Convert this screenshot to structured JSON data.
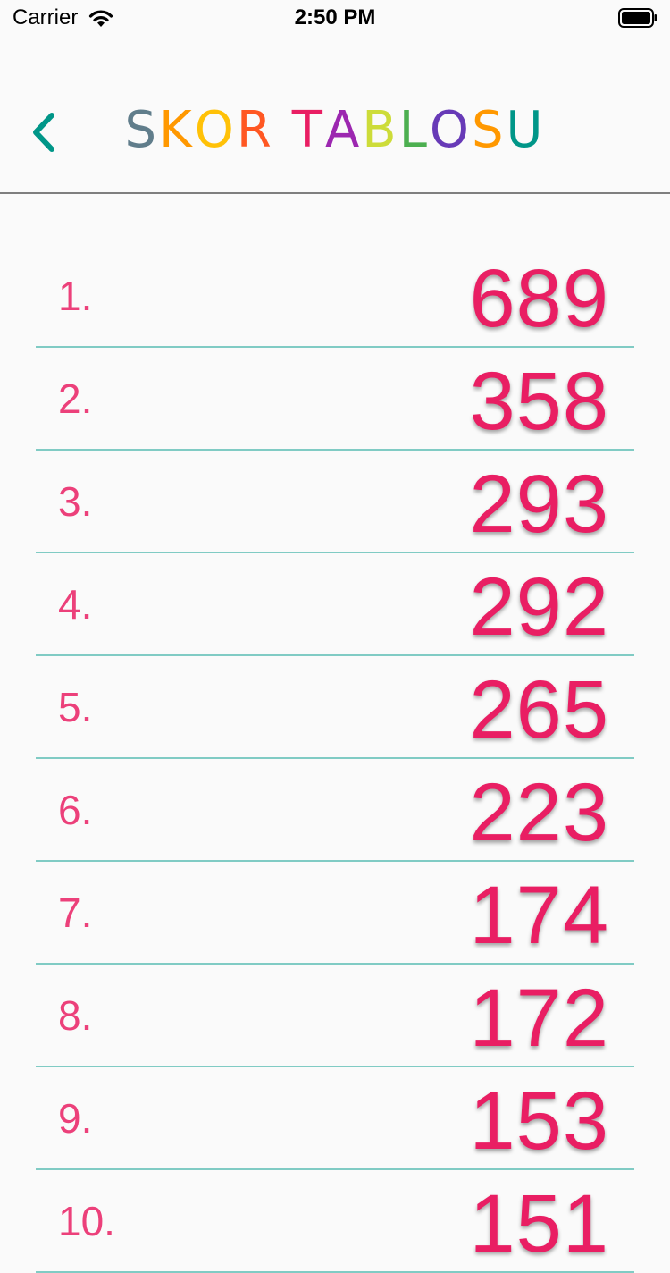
{
  "status_bar": {
    "carrier": "Carrier",
    "time": "2:50 PM"
  },
  "nav": {
    "back_icon": "chevron-left-icon",
    "title": "SKOR TABLOSU",
    "title_letters": [
      {
        "char": "S",
        "color": "#607d8b"
      },
      {
        "char": "K",
        "color": "#ff9800"
      },
      {
        "char": "O",
        "color": "#ffc107"
      },
      {
        "char": "R",
        "color": "#ff5722"
      },
      {
        "char": " ",
        "color": "#000000"
      },
      {
        "char": "T",
        "color": "#e91e63"
      },
      {
        "char": "A",
        "color": "#9c27b0"
      },
      {
        "char": "B",
        "color": "#cddc39"
      },
      {
        "char": "L",
        "color": "#4caf50"
      },
      {
        "char": "O",
        "color": "#673ab7"
      },
      {
        "char": "S",
        "color": "#ff9800"
      },
      {
        "char": "U",
        "color": "#009688"
      }
    ]
  },
  "colors": {
    "back": "#009688",
    "rank": "#ec407a",
    "score": "#e91e63",
    "divider": "#80cbc4"
  },
  "scores": [
    {
      "rank": "1.",
      "score": "689"
    },
    {
      "rank": "2.",
      "score": "358"
    },
    {
      "rank": "3.",
      "score": "293"
    },
    {
      "rank": "4.",
      "score": "292"
    },
    {
      "rank": "5.",
      "score": "265"
    },
    {
      "rank": "6.",
      "score": "223"
    },
    {
      "rank": "7.",
      "score": "174"
    },
    {
      "rank": "8.",
      "score": "172"
    },
    {
      "rank": "9.",
      "score": "153"
    },
    {
      "rank": "10.",
      "score": "151"
    }
  ]
}
